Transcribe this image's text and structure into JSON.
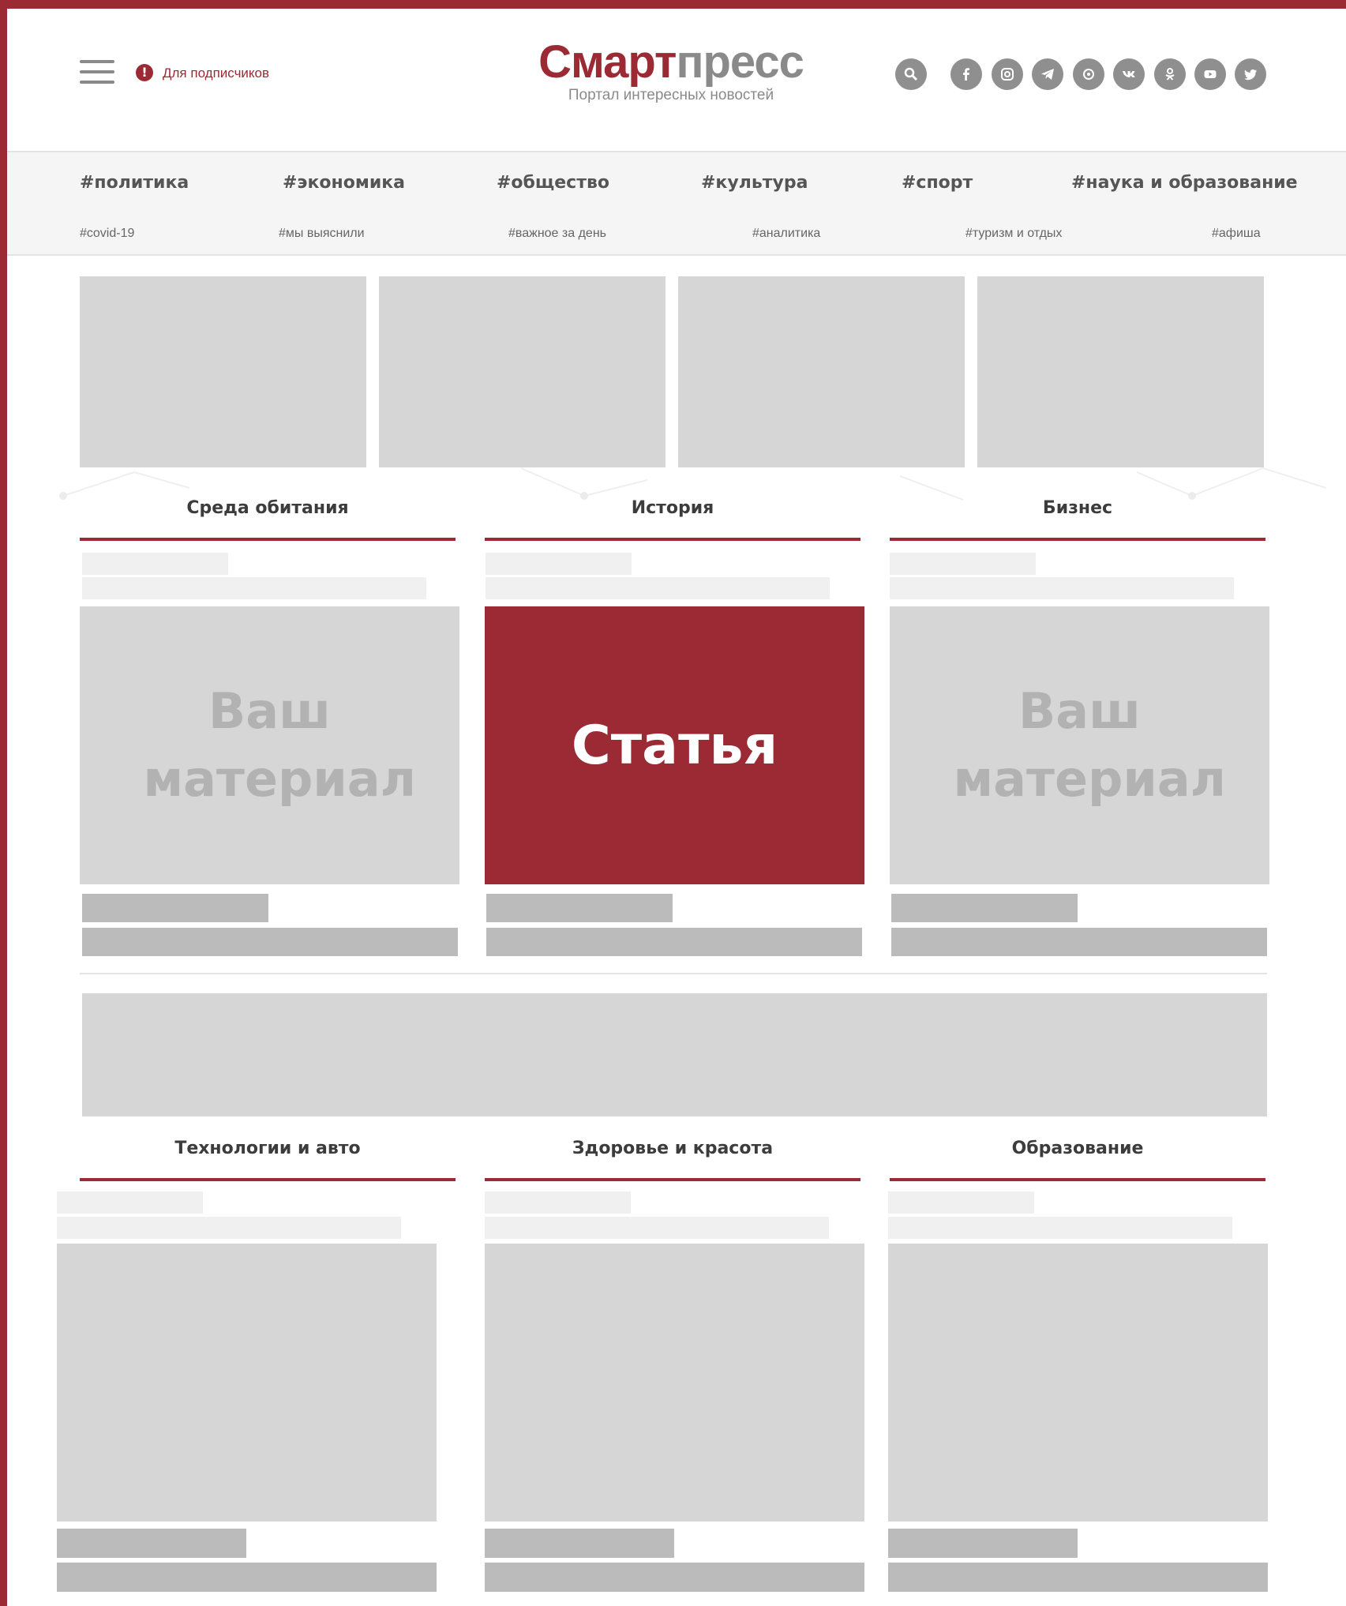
{
  "header": {
    "subscribers_label": "Для подписчиков",
    "logo_part1": "Смарт",
    "logo_part2": "пресс",
    "tagline": "Портал интересных новостей",
    "icons": [
      "search-icon",
      "facebook-icon",
      "instagram-icon",
      "telegram-icon",
      "odnoklassniki-icon",
      "vk-icon",
      "ok-icon",
      "youtube-icon",
      "twitter-icon"
    ]
  },
  "nav": {
    "primary": [
      "#политика",
      "#экономика",
      "#общество",
      "#культура",
      "#спорт",
      "#наука и образование"
    ],
    "secondary": [
      "#covid-19",
      "#мы выяснили",
      "#важное за день",
      "#аналитика",
      "#туризм и отдых",
      "#афиша"
    ]
  },
  "sections_row1": [
    {
      "title": "Среда обитания",
      "card": "Ваш материал"
    },
    {
      "title": "История",
      "card": "Статья"
    },
    {
      "title": "Бизнес",
      "card": "Ваш материал"
    }
  ],
  "sections_row2": [
    {
      "title": "Технологии и авто"
    },
    {
      "title": "Здоровье и красота"
    },
    {
      "title": "Образование"
    }
  ],
  "colors": {
    "accent": "#9b2a35",
    "placeholder": "#d6d6d6",
    "placeholder_dark": "#bbbbbb",
    "placeholder_light": "#f0f0f0",
    "nav_band": "#f5f5f5"
  }
}
